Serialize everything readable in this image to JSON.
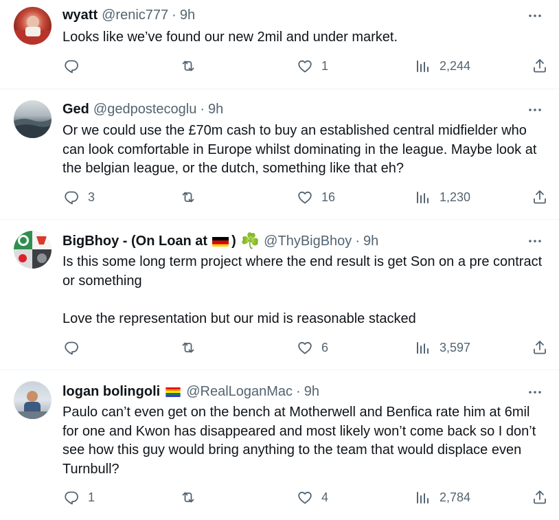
{
  "tweets": [
    {
      "name": "wyatt",
      "handle": "@renic777",
      "time": "9h",
      "text": "Looks like we’ve found our new 2mil and under market.",
      "replies": "",
      "reposts": "",
      "likes": "1",
      "views": "2,244"
    },
    {
      "name": "Ged",
      "handle": "@gedpostecoglu",
      "time": "9h",
      "text": "Or we could use the £70m cash to buy an established central midfielder who can look comfortable in Europe whilst dominating in the league. Maybe look at the belgian league, or the dutch, something like that eh?",
      "replies": "3",
      "reposts": "",
      "likes": "16",
      "views": "1,230"
    },
    {
      "name": "BigBhoy - (On Loan at",
      "name_suffix": ")",
      "handle": "@ThyBigBhoy",
      "time": "9h",
      "text": "Is this some long term project where the end result is get Son on a pre contract or something\n\nLove the representation but our mid is reasonable stacked",
      "replies": "",
      "reposts": "",
      "likes": "6",
      "views": "3,597"
    },
    {
      "name": "logan bolingoli",
      "handle": "@RealLoganMac",
      "time": "9h",
      "text": "Paulo can’t even get on the bench at Motherwell and Benfica rate him at 6mil for one and Kwon has disappeared and most likely won’t come back so I don’t see how this guy would bring anything to the team that would displace even Turnbull?",
      "replies": "1",
      "reposts": "",
      "likes": "4",
      "views": "2,784"
    }
  ],
  "separator": "·",
  "shamrock": "☘️",
  "colors": {
    "text": "#0f1419",
    "secondary": "#536471",
    "divider": "#eff3f4",
    "shamrock": "#2e9e3e"
  },
  "icons": [
    "reply-icon",
    "repost-icon",
    "like-icon",
    "views-icon",
    "share-icon",
    "more-icon",
    "germany-flag",
    "pride-flag",
    "shamrock-icon"
  ]
}
